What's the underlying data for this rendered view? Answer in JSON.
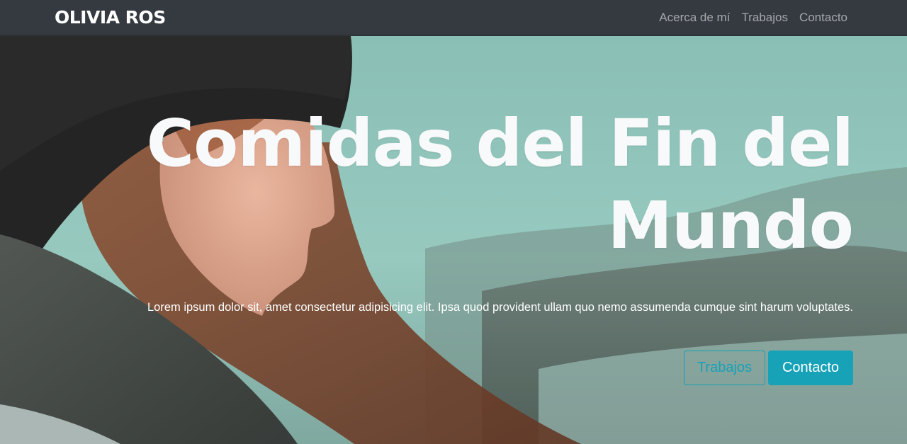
{
  "navbar": {
    "brand": "OLIVIA ROS",
    "links": [
      {
        "label": "Acerca de mí"
      },
      {
        "label": "Trabajos"
      },
      {
        "label": "Contacto"
      }
    ]
  },
  "hero": {
    "title": "Comidas del Fin del Mundo",
    "lead": "Lorem ipsum dolor sit, amet consectetur adipisicing elit. Ipsa quod provident ullam quo nemo assumenda cumque sint harum voluptates.",
    "buttons": {
      "secondary_label": "Trabajos",
      "primary_label": "Contacto"
    }
  },
  "colors": {
    "navbar_bg": "#343a40",
    "accent": "#17a2b8",
    "hero_sky": "#8fc4ba"
  }
}
